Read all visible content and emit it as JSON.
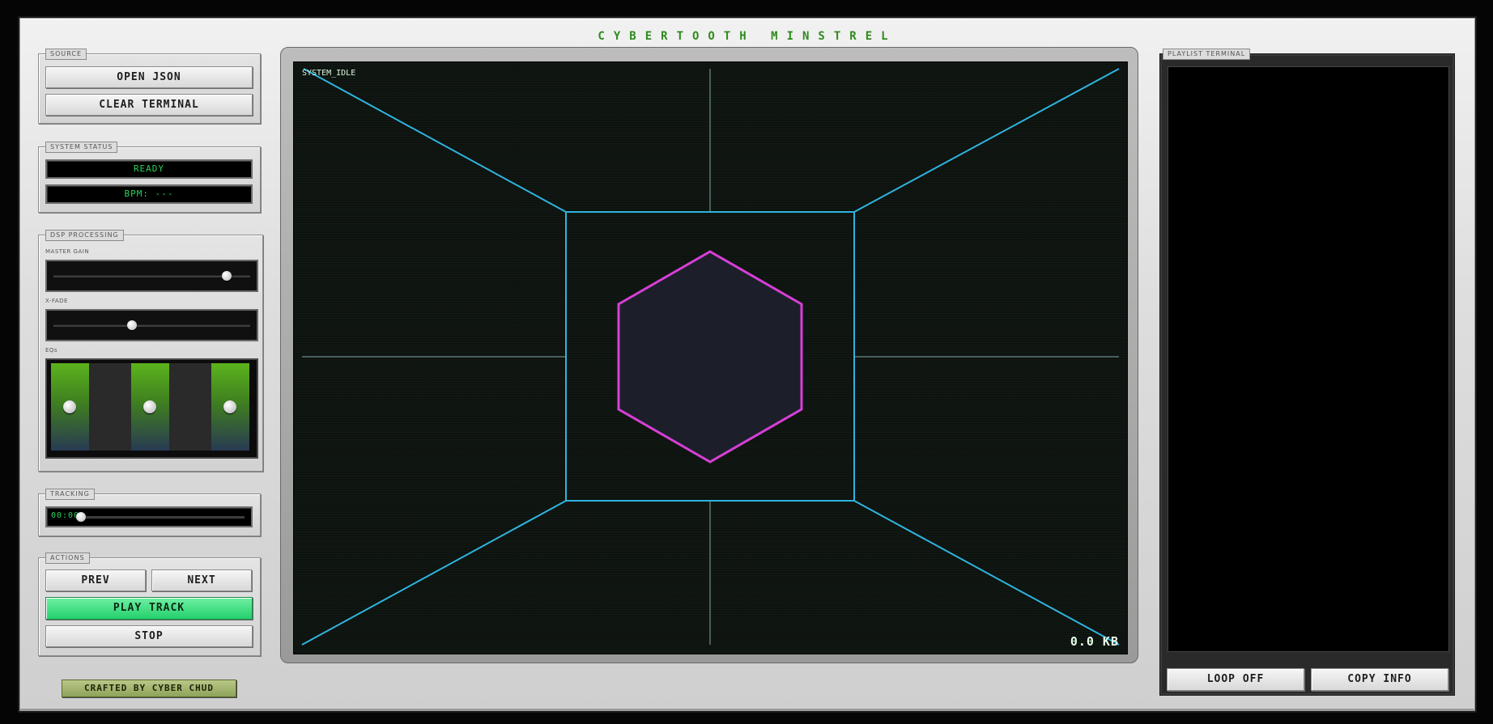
{
  "app": {
    "title": "CYBERTOOTH MINSTREL"
  },
  "source": {
    "label": "SOURCE",
    "open_json": "OPEN JSON",
    "clear_terminal": "CLEAR TERMINAL"
  },
  "system_status": {
    "label": "SYSTEM STATUS",
    "status": "READY",
    "bpm": "BPM: ---"
  },
  "dsp": {
    "label": "DSP PROCESSING",
    "master_gain_label": "MASTER GAIN",
    "master_gain_value": 0.88,
    "xfade_label": "X-FADE",
    "xfade_value": 0.4,
    "eq_label": "EQs",
    "eq_values": [
      0.5,
      0.5,
      0.5
    ]
  },
  "tracking": {
    "label": "TRACKING",
    "time": "00:00",
    "position": 0
  },
  "actions": {
    "label": "ACTIONS",
    "prev": "PREV",
    "next": "NEXT",
    "play": "PLAY TRACK",
    "stop": "STOP"
  },
  "credit": "CRAFTED BY CYBER CHUD",
  "visualizer": {
    "status": "SYSTEM_IDLE",
    "size_readout": "0.0 KB",
    "colors": {
      "tunnel": "#2fb4e0",
      "hexagon": "#d63fd6",
      "crosshair": "#6f8f8f"
    }
  },
  "playlist": {
    "label": "PLAYLIST TERMINAL",
    "loop": "LOOP OFF",
    "copy_info": "COPY INFO"
  }
}
